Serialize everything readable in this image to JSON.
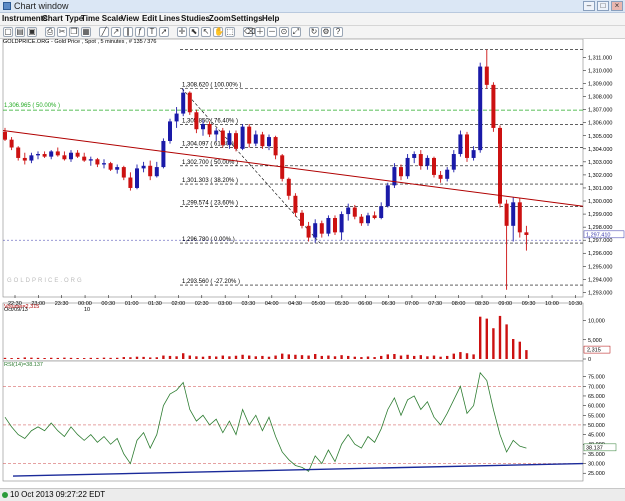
{
  "window": {
    "title": "Chart window"
  },
  "menu": [
    "Instruments",
    "Chart Type",
    "Time Scale",
    "View",
    "Edit",
    "Lines",
    "Studies",
    "Zoom",
    "Settings",
    "Help"
  ],
  "toolbar": {
    "icons": [
      "new-chart-icon",
      "open-icon",
      "save-icon",
      "print-icon",
      "cut-icon",
      "copy-icon",
      "paste-icon",
      "draw-line-icon",
      "trendline-icon",
      "channel-icon",
      "fibonacci-icon",
      "text-tool-icon",
      "arrow-icon",
      "crosshair-icon",
      "cursor-icon",
      "pointer-icon",
      "hand-icon",
      "select-icon",
      "eraser-icon",
      "zoom-in-icon",
      "zoom-out-icon",
      "zoom-reset-icon",
      "zoom-fit-icon",
      "refresh-icon",
      "settings-icon",
      "help-icon"
    ]
  },
  "chart": {
    "header": "GOLDPRICE.ORG - Gold Price , Spot , 5 minutes , # 135 / 376",
    "watermark": "GOLDPRICE.ORG",
    "volume_label": "Volume=2,315",
    "rsi_label": "RSI(14)=38.137",
    "date_label": "Oct/09/13",
    "date_day": "10",
    "x_ticks": [
      "22:30",
      "23:00",
      "23:30",
      "00:00",
      "00:30",
      "01:00",
      "01:30",
      "02:00",
      "02:30",
      "03:00",
      "03:30",
      "04:00",
      "04:30",
      "05:00",
      "05:30",
      "06:00",
      "06:30",
      "07:00",
      "07:30",
      "08:00",
      "08:30",
      "09:00",
      "09:30",
      "10:00",
      "10:30"
    ],
    "price_ticks": [
      "1,311.000",
      "1,310.000",
      "1,309.000",
      "1,308.000",
      "1,307.000",
      "1,306.000",
      "1,305.000",
      "1,304.000",
      "1,303.000",
      "1,302.000",
      "1,301.000",
      "1,300.000",
      "1,299.000",
      "1,298.000",
      "1,297.000",
      "1,296.000",
      "1,295.000",
      "1,294.000",
      "1,293.000"
    ],
    "last_price": "1,297.410",
    "last_price2": "1,297.000",
    "vol_ticks": [
      "10,000",
      "5,000",
      "0"
    ],
    "vol_last": "2,315",
    "rsi_ticks": [
      "75.000",
      "70.000",
      "65.000",
      "60.000",
      "55.000",
      "50.000",
      "45.000",
      "40.000",
      "35.000",
      "30.000",
      "25.000"
    ],
    "rsi_last": "38.137",
    "fib_levels": [
      {
        "label": "1,308.620 ( 100.00% )",
        "price": 1308.62
      },
      {
        "label": "1,305.850 ( 76.40% )",
        "price": 1305.85
      },
      {
        "label": "1,304.097 ( 61.80% )",
        "price": 1304.097
      },
      {
        "label": "1,302.700 ( 50.00% )",
        "price": 1302.7
      },
      {
        "label": "1,301.303 ( 38.20% )",
        "price": 1301.303
      },
      {
        "label": "1,299.574 ( 23.60% )",
        "price": 1299.574
      },
      {
        "label": "1,296.780 ( 0.00% )",
        "price": 1296.78
      },
      {
        "label": "1,293.560 ( -27.20% )",
        "price": 1293.56
      }
    ],
    "green_level": {
      "label": "1,306.965 ( 50.00% )",
      "price": 1306.965
    },
    "top_level": 1311.6,
    "colors": {
      "up": "#1a1aa8",
      "down": "#cc1111",
      "trend": "#b00000",
      "rsi": "#2e7d32",
      "rsi_trend": "#1a2a9a",
      "green": "#22aa22"
    }
  },
  "chart_data": {
    "type": "candlestick",
    "price_range": [
      1292.8,
      1311.8
    ],
    "volume_range": [
      0,
      13000
    ],
    "rsi_range": [
      22,
      80
    ],
    "candles": [
      [
        1305.3,
        1305.6,
        1304.6,
        1304.7
      ],
      [
        1304.7,
        1304.9,
        1303.9,
        1304.1
      ],
      [
        1304.1,
        1304.2,
        1303.1,
        1303.3
      ],
      [
        1303.3,
        1303.7,
        1302.8,
        1303.1
      ],
      [
        1303.1,
        1303.7,
        1302.9,
        1303.5
      ],
      [
        1303.5,
        1303.8,
        1303.2,
        1303.6
      ],
      [
        1303.6,
        1303.8,
        1303.3,
        1303.4
      ],
      [
        1303.4,
        1303.9,
        1303.2,
        1303.8
      ],
      [
        1303.8,
        1304.1,
        1303.4,
        1303.5
      ],
      [
        1303.5,
        1303.8,
        1303.1,
        1303.2
      ],
      [
        1303.2,
        1303.9,
        1303.0,
        1303.7
      ],
      [
        1303.7,
        1303.9,
        1303.3,
        1303.4
      ],
      [
        1303.4,
        1303.7,
        1303.0,
        1303.1
      ],
      [
        1303.1,
        1303.4,
        1302.7,
        1303.2
      ],
      [
        1303.2,
        1303.3,
        1302.6,
        1302.8
      ],
      [
        1302.8,
        1303.2,
        1302.5,
        1302.9
      ],
      [
        1302.9,
        1303.0,
        1302.3,
        1302.4
      ],
      [
        1302.4,
        1302.8,
        1302.1,
        1302.6
      ],
      [
        1302.6,
        1302.7,
        1301.6,
        1301.8
      ],
      [
        1301.8,
        1302.2,
        1300.8,
        1301.0
      ],
      [
        1301.0,
        1302.8,
        1300.9,
        1302.5
      ],
      [
        1302.5,
        1303.0,
        1302.2,
        1302.7
      ],
      [
        1302.7,
        1303.1,
        1301.6,
        1301.9
      ],
      [
        1301.9,
        1303.0,
        1301.8,
        1302.6
      ],
      [
        1302.6,
        1304.8,
        1302.5,
        1304.6
      ],
      [
        1304.6,
        1306.3,
        1304.4,
        1306.1
      ],
      [
        1306.1,
        1307.2,
        1305.6,
        1306.7
      ],
      [
        1306.7,
        1308.6,
        1306.5,
        1308.3
      ],
      [
        1308.3,
        1308.4,
        1306.6,
        1306.8
      ],
      [
        1306.8,
        1307.0,
        1305.2,
        1305.5
      ],
      [
        1305.5,
        1306.2,
        1305.0,
        1305.9
      ],
      [
        1305.9,
        1306.1,
        1304.9,
        1305.1
      ],
      [
        1305.1,
        1305.6,
        1304.6,
        1305.4
      ],
      [
        1305.4,
        1305.6,
        1304.1,
        1304.3
      ],
      [
        1304.3,
        1305.4,
        1304.0,
        1305.2
      ],
      [
        1305.2,
        1305.4,
        1303.8,
        1304.0
      ],
      [
        1304.0,
        1305.9,
        1303.9,
        1305.7
      ],
      [
        1305.7,
        1305.9,
        1304.1,
        1304.4
      ],
      [
        1304.4,
        1305.4,
        1304.2,
        1305.1
      ],
      [
        1305.1,
        1305.3,
        1304.0,
        1304.2
      ],
      [
        1304.2,
        1305.1,
        1303.9,
        1304.9
      ],
      [
        1304.9,
        1305.0,
        1303.2,
        1303.5
      ],
      [
        1303.5,
        1303.6,
        1301.5,
        1301.7
      ],
      [
        1301.7,
        1301.8,
        1300.1,
        1300.4
      ],
      [
        1300.4,
        1300.6,
        1298.8,
        1299.1
      ],
      [
        1299.1,
        1299.3,
        1297.9,
        1298.1
      ],
      [
        1298.1,
        1298.4,
        1296.9,
        1297.2
      ],
      [
        1297.2,
        1298.6,
        1296.8,
        1298.3
      ],
      [
        1298.3,
        1298.5,
        1297.2,
        1297.5
      ],
      [
        1297.5,
        1298.9,
        1297.3,
        1298.7
      ],
      [
        1298.7,
        1298.9,
        1297.4,
        1297.6
      ],
      [
        1297.6,
        1299.2,
        1297.0,
        1299.0
      ],
      [
        1299.0,
        1299.8,
        1298.5,
        1299.5
      ],
      [
        1299.5,
        1299.7,
        1298.6,
        1298.8
      ],
      [
        1298.8,
        1299.0,
        1298.1,
        1298.3
      ],
      [
        1298.3,
        1299.1,
        1298.1,
        1298.9
      ],
      [
        1298.9,
        1299.2,
        1298.6,
        1298.7
      ],
      [
        1298.7,
        1299.9,
        1298.6,
        1299.6
      ],
      [
        1299.6,
        1301.4,
        1299.5,
        1301.2
      ],
      [
        1301.2,
        1302.9,
        1301.0,
        1302.6
      ],
      [
        1302.6,
        1302.8,
        1301.6,
        1301.9
      ],
      [
        1301.9,
        1303.6,
        1301.7,
        1303.3
      ],
      [
        1303.3,
        1303.8,
        1302.9,
        1303.6
      ],
      [
        1303.6,
        1303.9,
        1302.4,
        1302.7
      ],
      [
        1302.7,
        1303.5,
        1302.4,
        1303.3
      ],
      [
        1303.3,
        1303.4,
        1301.8,
        1302.0
      ],
      [
        1302.0,
        1302.3,
        1301.4,
        1301.7
      ],
      [
        1301.7,
        1302.6,
        1301.5,
        1302.4
      ],
      [
        1302.4,
        1303.9,
        1302.2,
        1303.6
      ],
      [
        1303.6,
        1305.4,
        1303.4,
        1305.1
      ],
      [
        1305.1,
        1305.3,
        1303.0,
        1303.3
      ],
      [
        1303.3,
        1304.2,
        1303.1,
        1303.9
      ],
      [
        1303.9,
        1310.6,
        1303.7,
        1310.3
      ],
      [
        1310.3,
        1311.6,
        1308.6,
        1308.9
      ],
      [
        1308.9,
        1309.1,
        1305.3,
        1305.6
      ],
      [
        1305.6,
        1305.8,
        1299.5,
        1299.8
      ],
      [
        1299.8,
        1300.1,
        1293.2,
        1298.1
      ],
      [
        1298.1,
        1300.3,
        1296.9,
        1299.9
      ],
      [
        1299.9,
        1300.2,
        1297.2,
        1297.6
      ],
      [
        1297.6,
        1298.1,
        1296.2,
        1297.4
      ]
    ],
    "volume": [
      300,
      250,
      280,
      400,
      350,
      300,
      260,
      320,
      280,
      350,
      300,
      260,
      240,
      300,
      280,
      350,
      300,
      320,
      500,
      450,
      600,
      550,
      400,
      450,
      900,
      800,
      700,
      1500,
      900,
      700,
      600,
      800,
      650,
      900,
      700,
      850,
      1100,
      900,
      700,
      800,
      600,
      900,
      1400,
      1200,
      1100,
      1000,
      900,
      1300,
      800,
      900,
      700,
      1000,
      800,
      600,
      500,
      650,
      500,
      800,
      1200,
      1300,
      900,
      1100,
      800,
      1000,
      700,
      900,
      600,
      800,
      1400,
      1800,
      1500,
      1200,
      11000,
      10500,
      8000,
      11200,
      9000,
      5200,
      4500,
      2315
    ],
    "rsi": [
      54,
      49,
      45,
      43,
      47,
      49,
      47,
      51,
      47,
      44,
      49,
      45,
      42,
      45,
      41,
      44,
      40,
      43,
      35,
      30,
      42,
      46,
      38,
      45,
      60,
      66,
      68,
      72,
      58,
      52,
      55,
      50,
      53,
      46,
      52,
      45,
      58,
      50,
      55,
      47,
      54,
      44,
      36,
      32,
      29,
      28,
      26,
      34,
      30,
      37,
      31,
      40,
      45,
      40,
      38,
      44,
      41,
      48,
      58,
      64,
      55,
      63,
      65,
      58,
      62,
      54,
      50,
      56,
      63,
      70,
      56,
      60,
      77,
      73,
      58,
      45,
      36,
      42,
      39,
      38
    ]
  }
}
